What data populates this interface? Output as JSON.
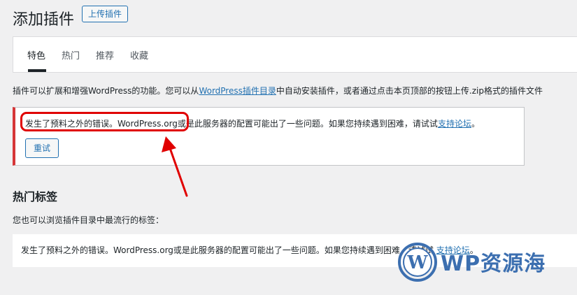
{
  "header": {
    "title": "添加插件",
    "upload_label": "上传插件"
  },
  "tabs": [
    {
      "label": "特色",
      "active": true
    },
    {
      "label": "热门",
      "active": false
    },
    {
      "label": "推荐",
      "active": false
    },
    {
      "label": "收藏",
      "active": false
    }
  ],
  "intro": {
    "before": "插件可以扩展和增强WordPress的功能。您可以从",
    "link": "WordPress插件目录",
    "after": "中自动安装插件，或者通过点击本页顶部的按钮上传.zip格式的插件文件"
  },
  "error_notice": {
    "message": "发生了预料之外的错误。WordPress.org或是此服务器的配置可能出了一些问题。如果您持续遇到困难，请试试",
    "link": "支持论坛",
    "end": "。",
    "retry_label": "重试",
    "border_color": "#d63638"
  },
  "popular_tags": {
    "title": "热门标签",
    "description": "您也可以浏览插件目录中最流行的标签：",
    "error_message": "发生了预料之外的错误。WordPress.org或是此服务器的配置可能出了一些问题。如果您持续遇到困难，请试试",
    "error_link": "支持论坛",
    "error_end": "。"
  },
  "annotation": {
    "color": "#e00000"
  },
  "watermark": {
    "text": "WP资源海",
    "color": "#3c6fb0"
  },
  "colors": {
    "link": "#2271b1",
    "background": "#f0f0f1"
  }
}
